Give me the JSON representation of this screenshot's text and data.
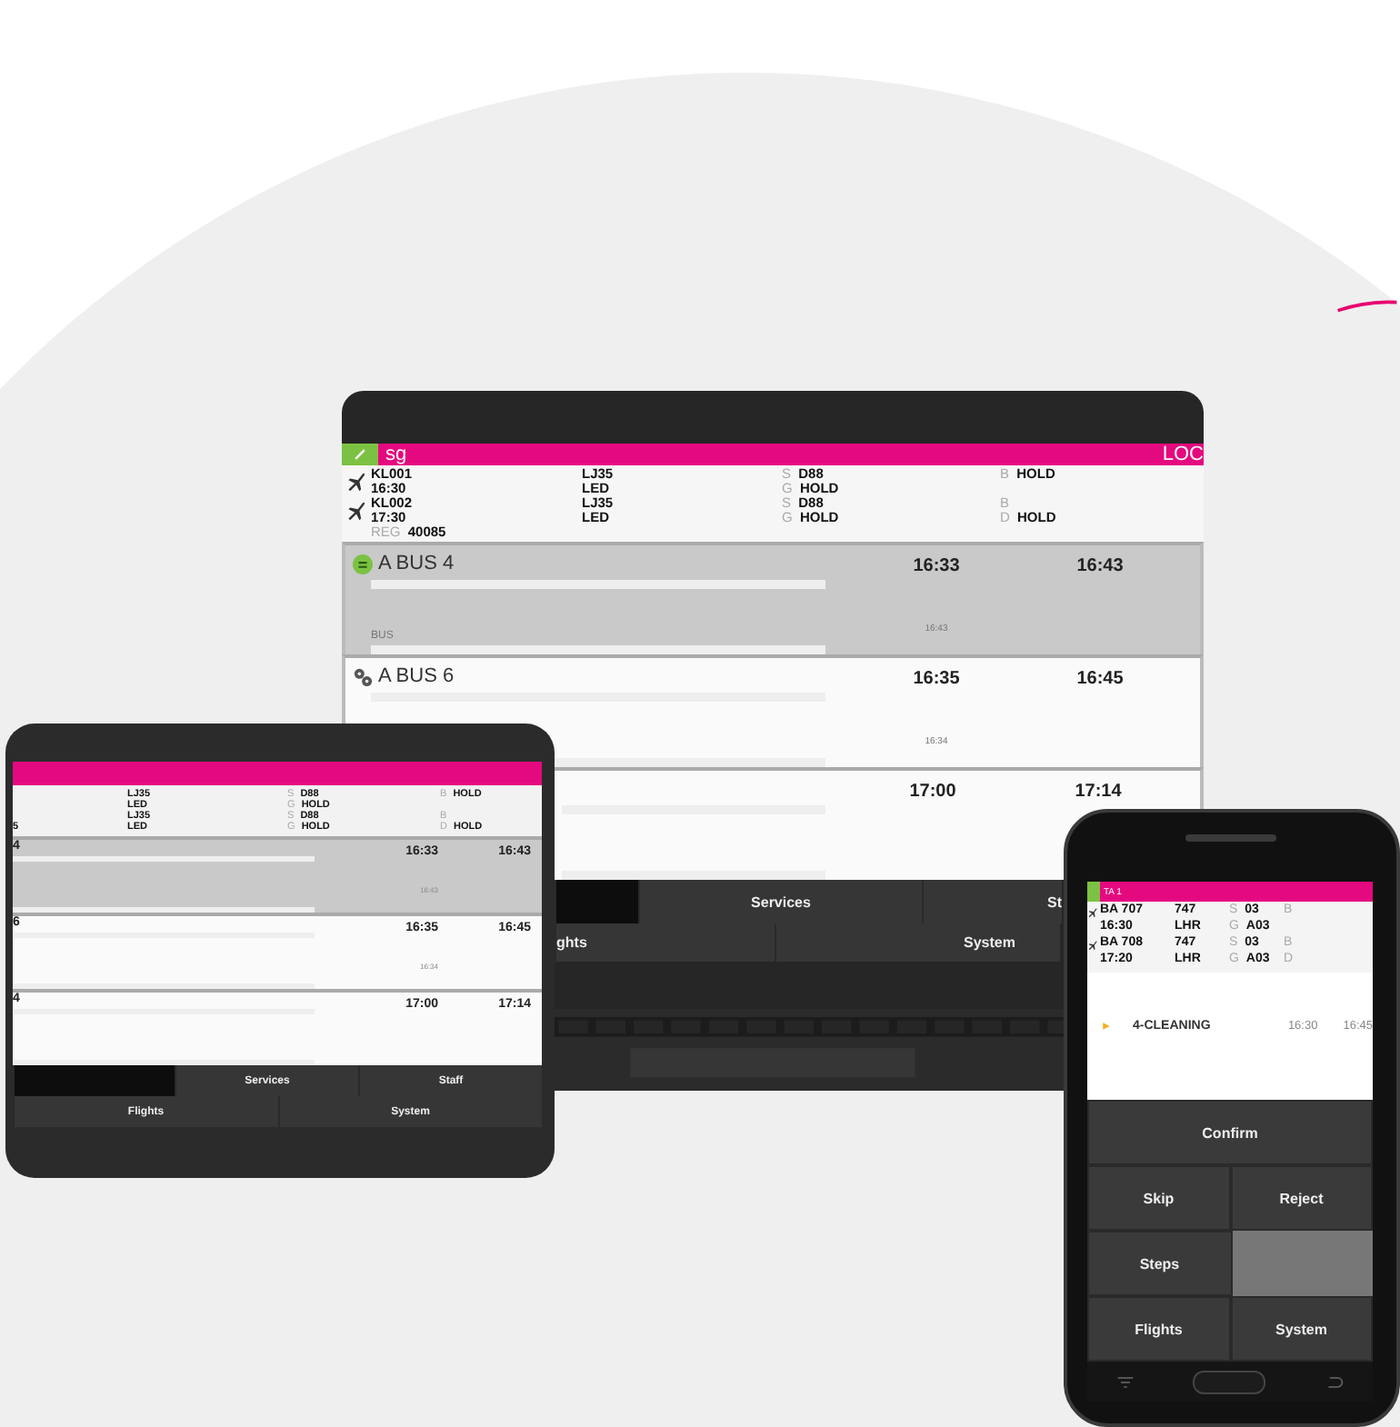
{
  "laptop": {
    "header": {
      "title": "sg",
      "right": "LOC"
    },
    "flights": [
      {
        "code": "KL001",
        "time": "16:30",
        "aircraft": "LJ35",
        "station": "LED",
        "col3": [
          {
            "prefix": "S",
            "value": "D88"
          },
          {
            "prefix": "G",
            "value": "HOLD"
          }
        ],
        "col4": [
          {
            "prefix": "B",
            "value": "HOLD"
          }
        ]
      },
      {
        "code": "KL002",
        "time": "17:30",
        "aircraft": "LJ35",
        "station": "LED",
        "col3": [
          {
            "prefix": "S",
            "value": "D88"
          },
          {
            "prefix": "G",
            "value": "HOLD"
          }
        ],
        "col4": [
          {
            "prefix": "B"
          },
          {
            "prefix": "D",
            "value": "HOLD"
          }
        ]
      }
    ],
    "reg": {
      "label": "REG",
      "value": "40085"
    },
    "tasks": [
      {
        "name": "A BUS 4",
        "kind": "status",
        "selected": true,
        "start": "16:33",
        "end": "16:43",
        "sub_label": "BUS",
        "sub_time": "16:43"
      },
      {
        "name": "A BUS 6",
        "kind": "gears",
        "selected": false,
        "start": "16:35",
        "end": "16:45",
        "sub_time": "16:34"
      },
      {
        "selected": false,
        "start": "17:00",
        "end": "17:14"
      }
    ],
    "nav": [
      [
        {
          "selected": true
        },
        {
          "label": "Services",
          "selected": false
        },
        {
          "label": "St",
          "selected": false
        }
      ],
      [
        {
          "label": "ghts",
          "selected": false
        },
        {
          "label": "System",
          "selected": false
        }
      ]
    ]
  },
  "tablet": {
    "flights": [
      {
        "aircraft": "LJ35",
        "station": "LED",
        "col3": [
          {
            "prefix": "S",
            "value": "D88"
          },
          {
            "prefix": "G",
            "value": "HOLD"
          }
        ],
        "col4": [
          {
            "prefix": "B",
            "value": "HOLD"
          }
        ]
      },
      {
        "aircraft": "LJ35",
        "station": "LED",
        "col3": [
          {
            "prefix": "S",
            "value": "D88"
          },
          {
            "prefix": "G",
            "value": "HOLD"
          }
        ],
        "col4": [
          {
            "prefix": "B"
          },
          {
            "prefix": "D",
            "value": "HOLD"
          }
        ]
      }
    ],
    "flights_footer": "5",
    "tasks": [
      {
        "name": "4",
        "selected": true,
        "start": "16:33",
        "end": "16:43",
        "sub_time": "16:43"
      },
      {
        "name": "6",
        "selected": false,
        "start": "16:35",
        "end": "16:45",
        "sub_time": "16:34"
      },
      {
        "name": "4",
        "selected": false,
        "start": "17:00",
        "end": "17:14"
      }
    ],
    "nav": [
      [
        {
          "selected": true
        },
        {
          "label": "Services",
          "selected": false
        },
        {
          "label": "Staff",
          "selected": false
        }
      ],
      [
        {
          "label": "Flights",
          "selected": false
        },
        {
          "label": "System",
          "selected": false
        }
      ]
    ]
  },
  "phone": {
    "header": {
      "title": "TA 1"
    },
    "flights": [
      {
        "code": "BA 707",
        "time": "16:30",
        "aircraft": "747",
        "station": "LHR",
        "col3": [
          {
            "prefix": "S",
            "value": "03"
          },
          {
            "prefix": "G",
            "value": "A03"
          }
        ],
        "col4": [
          {
            "prefix": "B"
          }
        ]
      },
      {
        "code": "BA 708",
        "time": "17:20",
        "aircraft": "747",
        "station": "LHR",
        "col3": [
          {
            "prefix": "S",
            "value": "03"
          },
          {
            "prefix": "G",
            "value": "A03"
          }
        ],
        "col4": [
          {
            "prefix": "B"
          },
          {
            "prefix": "D"
          }
        ]
      }
    ],
    "task": {
      "name": "4-CLEANING",
      "start": "16:30",
      "end": "16:45"
    },
    "buttons": [
      [
        {
          "kind": "button",
          "label": "Confirm"
        }
      ],
      [
        {
          "kind": "button",
          "label": "Skip"
        },
        {
          "kind": "button",
          "label": "Reject"
        }
      ],
      [
        {
          "kind": "button",
          "label": "Steps"
        },
        {
          "kind": "blank"
        }
      ],
      [
        {
          "kind": "button",
          "label": "Flights"
        },
        {
          "kind": "button",
          "label": "System"
        }
      ]
    ]
  }
}
